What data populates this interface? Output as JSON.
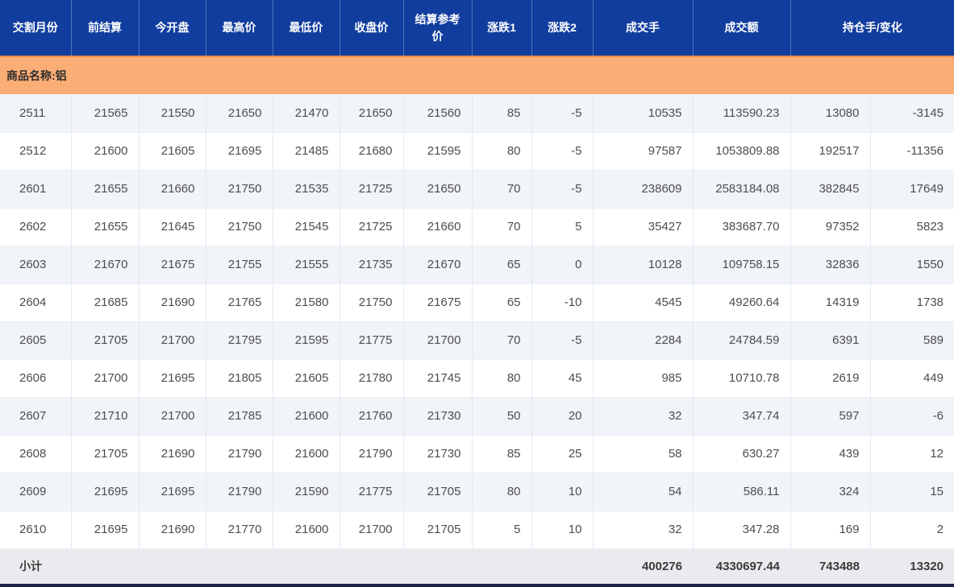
{
  "colors": {
    "header_bg": "#113D9E",
    "header_text": "#FFFFFF",
    "product_row_bg": "#FAAD75",
    "product_row_top_border": "#EF8A4B",
    "row_alt_bg": "#F1F4F9",
    "row_bg": "#FFFFFF",
    "subtotal_bg": "#EBEBEF",
    "data_text": "#4D4D4D",
    "bottom_bar": "#1C2747"
  },
  "table": {
    "headers": {
      "delivery_month": "交割月份",
      "prev_settlement": "前结算",
      "open": "今开盘",
      "high": "最高价",
      "low": "最低价",
      "close": "收盘价",
      "settlement_ref": "结算参考价",
      "change1": "涨跌1",
      "change2": "涨跌2",
      "volume": "成交手",
      "turnover": "成交额",
      "open_interest_change": "持仓手/变化"
    },
    "product_row_label": "商品名称:铝",
    "rows": [
      [
        "2511",
        "21565",
        "21550",
        "21650",
        "21470",
        "21650",
        "21560",
        "85",
        "-5",
        "10535",
        "113590.23",
        "13080",
        "-3145"
      ],
      [
        "2512",
        "21600",
        "21605",
        "21695",
        "21485",
        "21680",
        "21595",
        "80",
        "-5",
        "97587",
        "1053809.88",
        "192517",
        "-11356"
      ],
      [
        "2601",
        "21655",
        "21660",
        "21750",
        "21535",
        "21725",
        "21650",
        "70",
        "-5",
        "238609",
        "2583184.08",
        "382845",
        "17649"
      ],
      [
        "2602",
        "21655",
        "21645",
        "21750",
        "21545",
        "21725",
        "21660",
        "70",
        "5",
        "35427",
        "383687.70",
        "97352",
        "5823"
      ],
      [
        "2603",
        "21670",
        "21675",
        "21755",
        "21555",
        "21735",
        "21670",
        "65",
        "0",
        "10128",
        "109758.15",
        "32836",
        "1550"
      ],
      [
        "2604",
        "21685",
        "21690",
        "21765",
        "21580",
        "21750",
        "21675",
        "65",
        "-10",
        "4545",
        "49260.64",
        "14319",
        "1738"
      ],
      [
        "2605",
        "21705",
        "21700",
        "21795",
        "21595",
        "21775",
        "21700",
        "70",
        "-5",
        "2284",
        "24784.59",
        "6391",
        "589"
      ],
      [
        "2606",
        "21700",
        "21695",
        "21805",
        "21605",
        "21780",
        "21745",
        "80",
        "45",
        "985",
        "10710.78",
        "2619",
        "449"
      ],
      [
        "2607",
        "21710",
        "21700",
        "21785",
        "21600",
        "21760",
        "21730",
        "50",
        "20",
        "32",
        "347.74",
        "597",
        "-6"
      ],
      [
        "2608",
        "21705",
        "21690",
        "21790",
        "21600",
        "21790",
        "21730",
        "85",
        "25",
        "58",
        "630.27",
        "439",
        "12"
      ],
      [
        "2609",
        "21695",
        "21695",
        "21790",
        "21590",
        "21775",
        "21705",
        "80",
        "10",
        "54",
        "586.11",
        "324",
        "15"
      ],
      [
        "2610",
        "21695",
        "21690",
        "21770",
        "21600",
        "21700",
        "21705",
        "5",
        "10",
        "32",
        "347.28",
        "169",
        "2"
      ]
    ],
    "subtotal": {
      "label": "小计",
      "volume": "400276",
      "turnover": "4330697.44",
      "open_interest": "743488",
      "oi_change": "13320"
    }
  }
}
